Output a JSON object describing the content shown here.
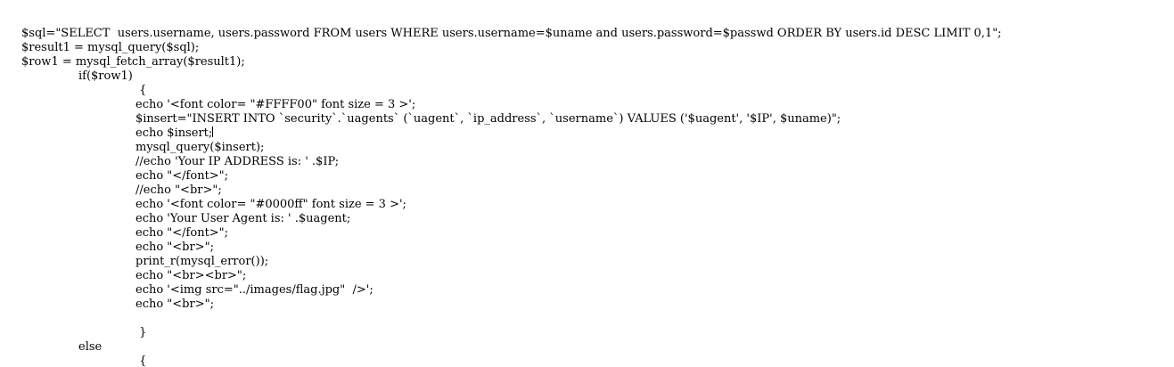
{
  "code": {
    "lines": [
      "$sql=\"SELECT  users.username, users.password FROM users WHERE users.username=$uname and users.password=$passwd ORDER BY users.id DESC LIMIT 0,1\";",
      "$result1 = mysql_query($sql);",
      "$row1 = mysql_fetch_array($result1);",
      "if($row1)",
      " {",
      "echo '<font color= \"#FFFF00\" font size = 3 >';",
      "$insert=\"INSERT INTO `security`.`uagents` (`uagent`, `ip_address`, `username`) VALUES ('$uagent', '$IP', $uname)\";",
      "echo $insert;",
      "mysql_query($insert);",
      "//echo 'Your IP ADDRESS is: ' .$IP;",
      "echo \"</font>\";",
      "//echo \"<br>\";",
      "echo '<font color= \"#0000ff\" font size = 3 >';",
      "echo 'Your User Agent is: ' .$uagent;",
      "echo \"</font>\";",
      "echo \"<br>\";",
      "print_r(mysql_error());",
      "echo \"<br><br>\";",
      "echo '<img src=\"../images/flag.jpg\"  />';",
      "echo \"<br>\";",
      "",
      " }",
      "else",
      " {"
    ]
  }
}
